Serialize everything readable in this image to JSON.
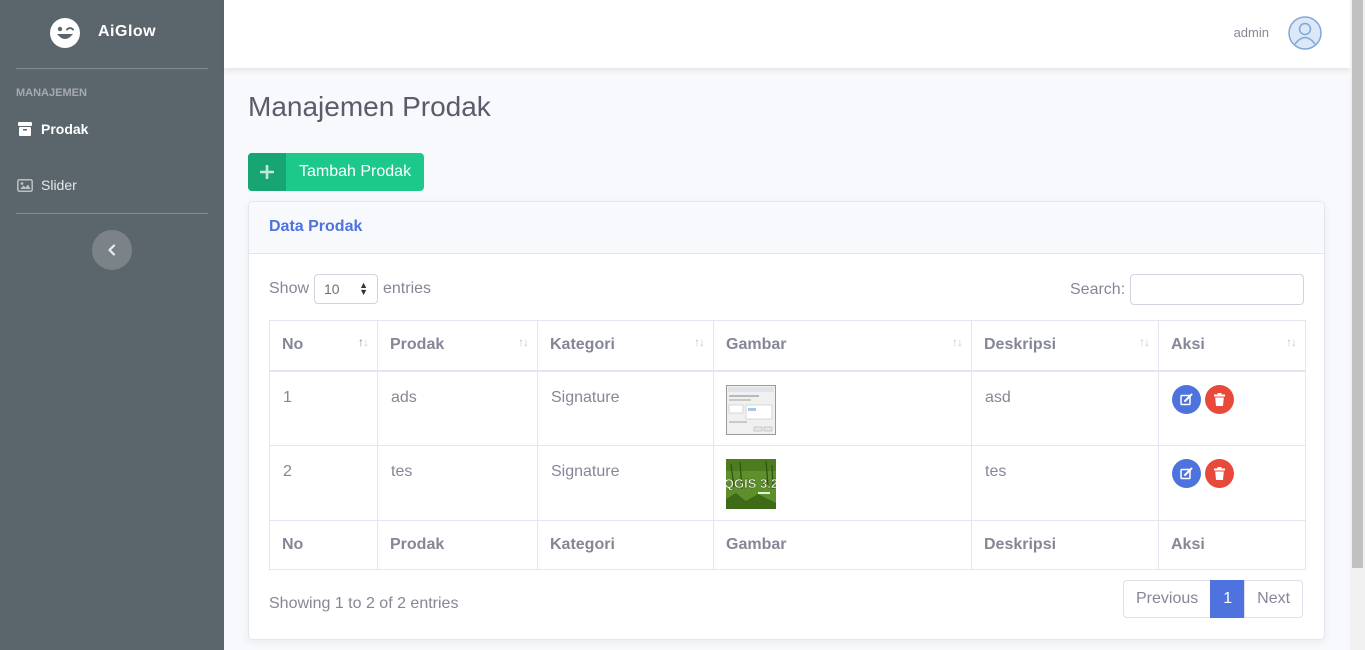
{
  "sidebar": {
    "brand": "AiGlow",
    "section_heading": "MANAJEMEN",
    "items": [
      {
        "label": "Prodak",
        "icon": "box-icon",
        "active": true
      },
      {
        "label": "Slider",
        "icon": "image-icon",
        "active": false
      }
    ]
  },
  "topbar": {
    "user": "admin"
  },
  "page": {
    "title": "Manajemen Prodak",
    "add_button": "Tambah Prodak"
  },
  "card": {
    "title": "Data Prodak",
    "show_label": "Show",
    "entries_label": "entries",
    "page_length": "10",
    "search_label": "Search:",
    "search_value": "",
    "columns": [
      "No",
      "Prodak",
      "Kategori",
      "Gambar",
      "Deskripsi",
      "Aksi"
    ],
    "rows": [
      {
        "no": "1",
        "prodak": "ads",
        "kategori": "Signature",
        "gambar": "screenshot-thumbnail",
        "deskripsi": "asd"
      },
      {
        "no": "2",
        "prodak": "tes",
        "kategori": "Signature",
        "gambar": "qgis-3.2-thumbnail",
        "deskripsi": "tes"
      }
    ],
    "info": "Showing 1 to 2 of 2 entries",
    "pagination": {
      "previous": "Previous",
      "current": "1",
      "next": "Next"
    }
  },
  "colors": {
    "sidebar_bg": "#5a656c",
    "primary": "#4e73df",
    "success": "#1cc88a",
    "danger": "#e74a3b"
  }
}
